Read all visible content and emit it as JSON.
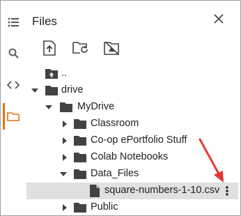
{
  "panel": {
    "title": "Files"
  },
  "icons": {
    "rail": [
      "table-of-contents-icon",
      "search-icon",
      "code-icon",
      "folder-icon"
    ],
    "toolbar": [
      "upload-icon",
      "refresh-folder-icon",
      "unmount-drive-icon"
    ],
    "close": "close-icon",
    "more": "more-vert-icon",
    "accent_color": "#e8710a",
    "annotation_arrow_color": "#e53935"
  },
  "tree": {
    "parent": "..",
    "drive": "drive",
    "mydrive": "MyDrive",
    "folders": [
      "Classroom",
      "Co-op ePortfolio Stuff",
      "Colab Notebooks",
      "Data_Files"
    ],
    "file": "square-numbers-1-10.csv",
    "public": "Public"
  }
}
